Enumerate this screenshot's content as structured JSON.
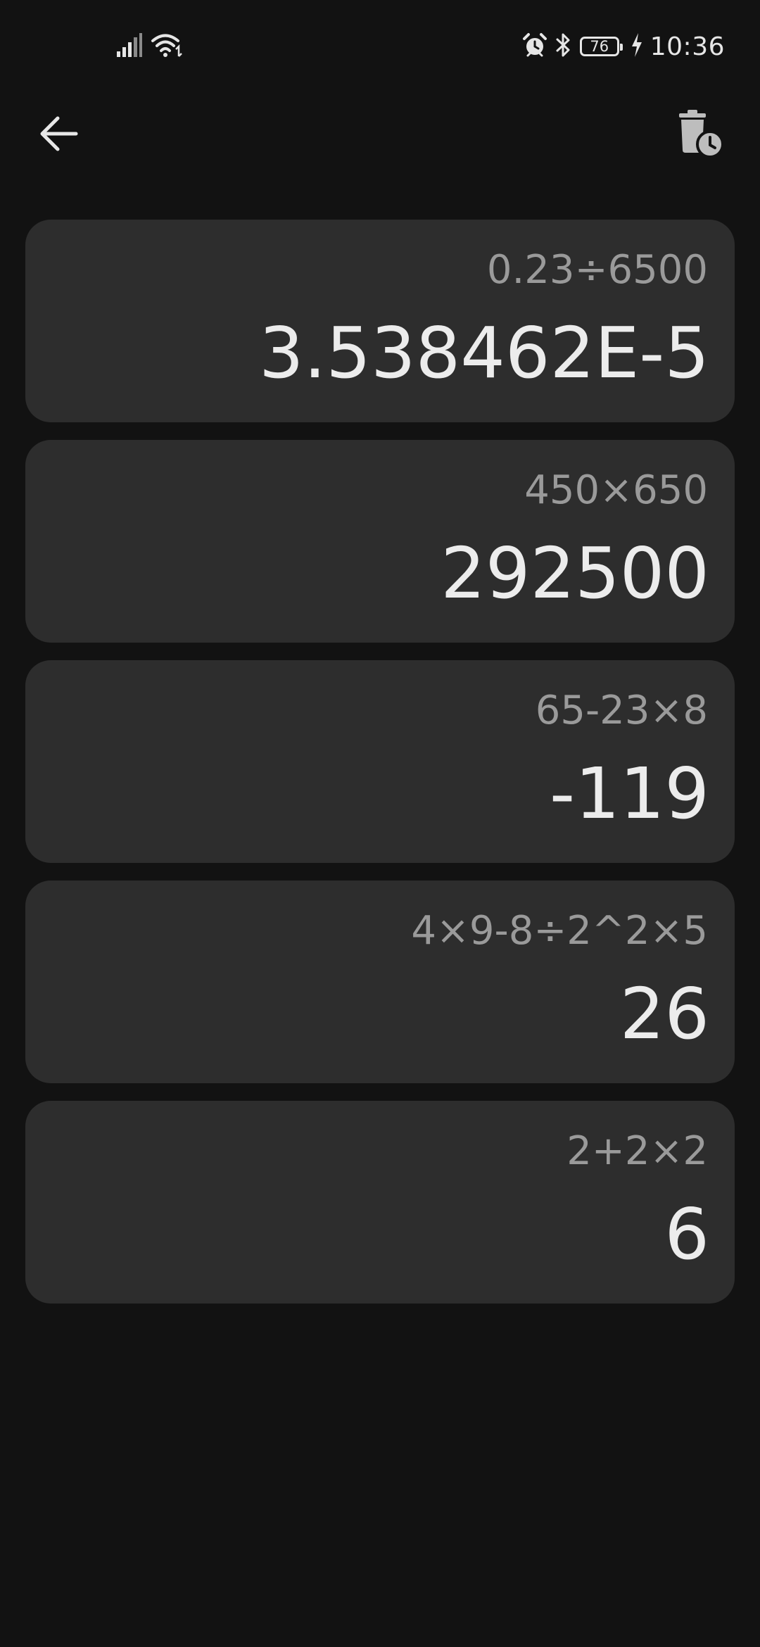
{
  "status_bar": {
    "battery_level": "76",
    "time": "10:36",
    "icons": [
      "signal-icon",
      "wifi-icon",
      "alarm-icon",
      "bluetooth-icon",
      "battery-icon",
      "charging-icon"
    ]
  },
  "toolbar": {
    "back_icon": "arrow-left-icon",
    "clear_history_icon": "trash-clock-icon"
  },
  "history": [
    {
      "expression": "0.23÷6500",
      "result": "3.538462E-5"
    },
    {
      "expression": "450×650",
      "result": "292500"
    },
    {
      "expression": "65-23×8",
      "result": "-119"
    },
    {
      "expression": "4×9-8÷2^2×5",
      "result": "26"
    },
    {
      "expression": "2+2×2",
      "result": "6"
    }
  ],
  "colors": {
    "background": "#121212",
    "card": "#2d2d2d",
    "expression_text": "#9a9a9a",
    "result_text": "#ececec"
  }
}
